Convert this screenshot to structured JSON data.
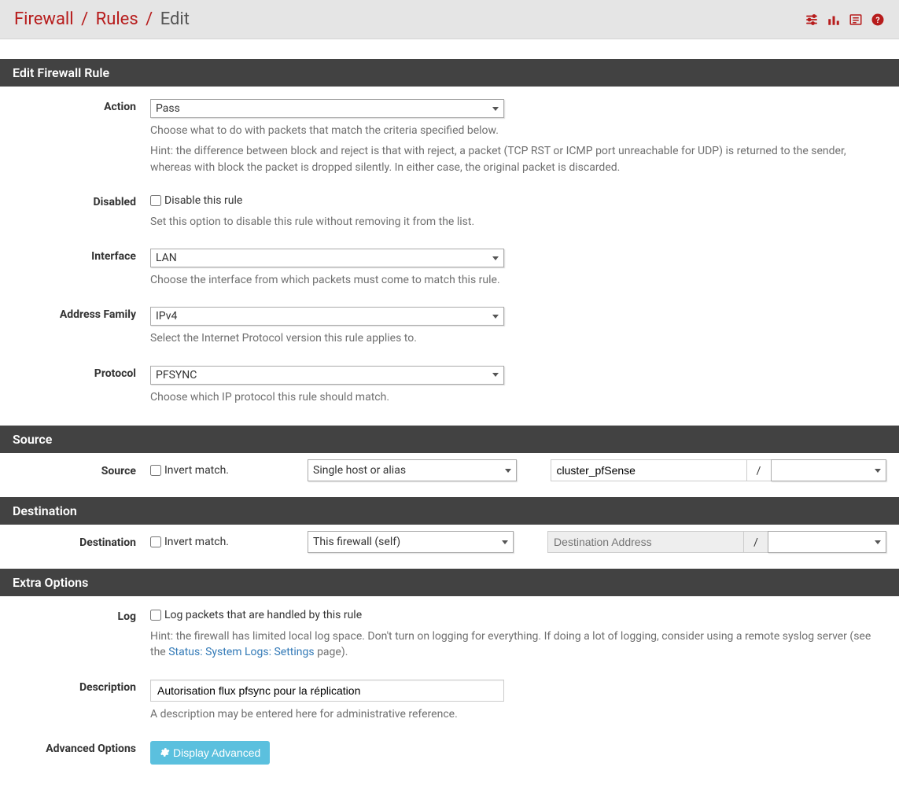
{
  "breadcrumb": {
    "l1": "Firewall",
    "l2": "Rules",
    "l3": "Edit"
  },
  "panels": {
    "edit": {
      "heading": "Edit Firewall Rule",
      "action": {
        "label": "Action",
        "value": "Pass",
        "help": "Choose what to do with packets that match the criteria specified below.",
        "hint": "Hint: the difference between block and reject is that with reject, a packet (TCP RST or ICMP port unreachable for UDP) is returned to the sender, whereas with block the packet is dropped silently. In either case, the original packet is discarded."
      },
      "disabled": {
        "label": "Disabled",
        "check": "Disable this rule",
        "help": "Set this option to disable this rule without removing it from the list."
      },
      "interface": {
        "label": "Interface",
        "value": "LAN",
        "help": "Choose the interface from which packets must come to match this rule."
      },
      "family": {
        "label": "Address Family",
        "value": "IPv4",
        "help": "Select the Internet Protocol version this rule applies to."
      },
      "protocol": {
        "label": "Protocol",
        "value": "PFSYNC",
        "help": "Choose which IP protocol this rule should match."
      }
    },
    "source": {
      "heading": "Source",
      "label": "Source",
      "invert": "Invert match.",
      "type": "Single host or alias",
      "address": "cluster_pfSense",
      "mask": ""
    },
    "dest": {
      "heading": "Destination",
      "label": "Destination",
      "invert": "Invert match.",
      "type": "This firewall (self)",
      "placeholder": "Destination Address",
      "mask": ""
    },
    "extra": {
      "heading": "Extra Options",
      "log": {
        "label": "Log",
        "check": "Log packets that are handled by this rule",
        "hintPre": "Hint: the firewall has limited local log space. Don't turn on logging for everything. If doing a lot of logging, consider using a remote syslog server (see the ",
        "link": "Status: System Logs: Settings",
        "hintPost": " page)."
      },
      "desc": {
        "label": "Description",
        "value": "Autorisation flux pfsync pour la réplication",
        "help": "A description may be entered here for administrative reference."
      },
      "adv": {
        "label": "Advanced Options",
        "button": "Display Advanced"
      }
    }
  }
}
